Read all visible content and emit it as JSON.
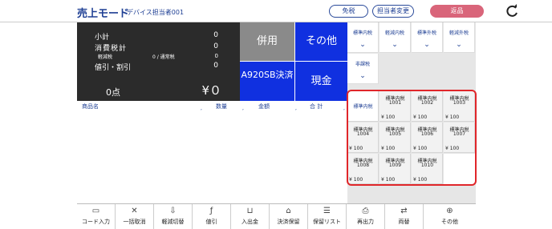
{
  "header": {
    "title": "売上モード",
    "operator": "デバイス担当者001",
    "buttons": [
      "免税",
      "担当者変更",
      "返品"
    ]
  },
  "summary": {
    "subtotal_label": "小計",
    "subtotal_value": "0",
    "tax_label": "消費税計",
    "tax_value": "0",
    "reduced_label": "軽減税",
    "reduced_mid": "0 / 通常税",
    "reduced_value": "0",
    "discount_label": "値引・割引",
    "discount_value": "0",
    "count": "0点",
    "total": "¥０"
  },
  "payment": {
    "combined": "併用",
    "other": "その他",
    "a920": "A920SB決済",
    "cash": "現金"
  },
  "tax_buttons": [
    "標準内税",
    "軽減内税",
    "標準外税",
    "軽減外税",
    "非課税"
  ],
  "list_headers": {
    "product": "商品名",
    "qty": "数量",
    "amount": "金額",
    "total": "合 計"
  },
  "products": [
    {
      "name": "標準内税",
      "code": "",
      "price": ""
    },
    {
      "name": "標準内税",
      "code": "1001",
      "price": "¥ 100"
    },
    {
      "name": "標準内税",
      "code": "1002",
      "price": "¥ 100"
    },
    {
      "name": "標準内税",
      "code": "1003",
      "price": "¥ 100"
    },
    {
      "name": "標準内税",
      "code": "1004",
      "price": "¥ 100"
    },
    {
      "name": "標準内税",
      "code": "1005",
      "price": "¥ 100"
    },
    {
      "name": "標準内税",
      "code": "1006",
      "price": "¥ 100"
    },
    {
      "name": "標準内税",
      "code": "1007",
      "price": "¥ 100"
    },
    {
      "name": "標準内税",
      "code": "1008",
      "price": "¥ 100"
    },
    {
      "name": "標準内税",
      "code": "1009",
      "price": "¥ 100"
    },
    {
      "name": "標準内税",
      "code": "1010",
      "price": "¥ 100"
    }
  ],
  "footer": [
    {
      "label": "コード入力",
      "icon": "barcode-icon"
    },
    {
      "label": "一括取消",
      "icon": "close-icon"
    },
    {
      "label": "軽減切替",
      "icon": "switch-icon"
    },
    {
      "label": "値引",
      "icon": "discount-icon"
    },
    {
      "label": "入出金",
      "icon": "cashbox-icon"
    },
    {
      "label": "決済保留",
      "icon": "basket-icon"
    },
    {
      "label": "保留リスト",
      "icon": "list-icon"
    },
    {
      "label": "再出力",
      "icon": "printer-icon"
    },
    {
      "label": "両替",
      "icon": "exchange-icon"
    },
    {
      "label": "その他",
      "icon": "plus-icon"
    }
  ],
  "colors": {
    "brand": "#1e3f94",
    "blue_button": "#1030e0",
    "return_button": "#d9657a",
    "highlight": "#e0262a"
  }
}
